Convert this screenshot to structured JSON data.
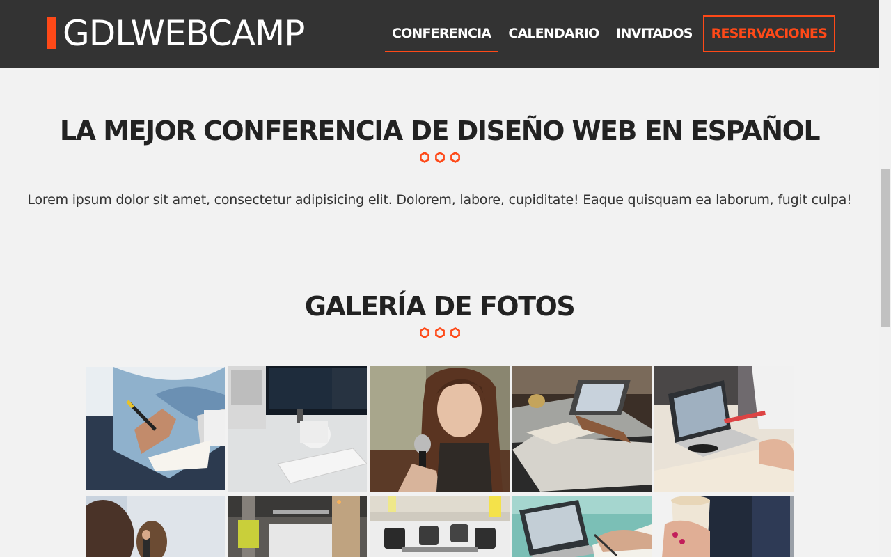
{
  "header": {
    "logo": "GDLWEBCAMP",
    "nav": [
      {
        "label": "CONFERENCIA",
        "active": true
      },
      {
        "label": "CALENDARIO",
        "active": false
      },
      {
        "label": "INVITADOS",
        "active": false
      },
      {
        "label": "RESERVACIONES",
        "active": false
      }
    ]
  },
  "intro": {
    "title": "LA MEJOR CONFERENCIA DE DISEÑO WEB EN ESPAÑOL",
    "text": "Lorem ipsum dolor sit amet, consectetur adipisicing elit. Dolorem, labore, cupiditate! Eaque quisquam ea laborum, fugit culpa!"
  },
  "gallery": {
    "title": "GALERÍA DE FOTOS",
    "photos": [
      "hand-writing-notes-photo",
      "desk-monitor-mug-photo",
      "woman-speaking-microphone-photo",
      "hands-drawing-laptop-photo",
      "laptops-desk-meeting-photo",
      "audience-presentation-photo",
      "office-space-photo",
      "conference-room-chairs-photo",
      "laptop-hand-writing-photo",
      "person-holding-cup-photo"
    ]
  },
  "colors": {
    "accent": "#fe4918",
    "header_bg": "#333333",
    "page_bg": "#f2f2f2"
  }
}
